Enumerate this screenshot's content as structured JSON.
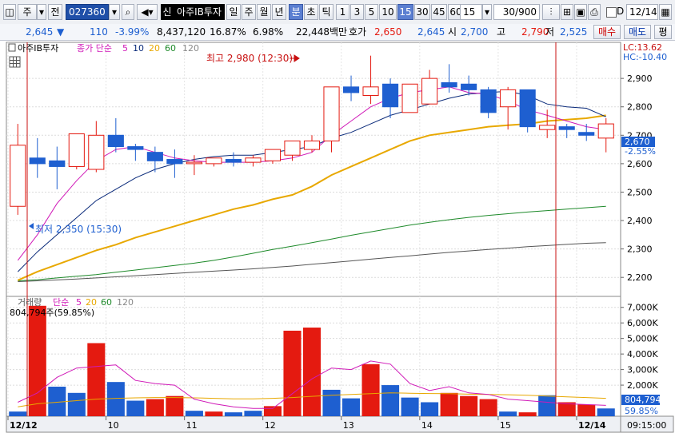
{
  "toolbar": {
    "market": "주",
    "board": "전",
    "code": "027360",
    "company_badge": "신",
    "company": "아주IB투자",
    "periods": [
      "일",
      "주",
      "월",
      "년",
      "분",
      "초",
      "틱"
    ],
    "active_period": "분",
    "intervals": [
      "1",
      "3",
      "5",
      "10",
      "15",
      "30",
      "45",
      "60"
    ],
    "active_interval": "15",
    "interval_value": "15",
    "count": "30/900",
    "d_label": "D",
    "date": "12/14"
  },
  "quote": {
    "price": "2,645",
    "direction": "▼",
    "change": "110",
    "change_pct": "-3.99%",
    "volume": "8,437,120",
    "turnover": "16.87%",
    "ratio": "6.98%",
    "amount": "22,448백만",
    "ask_label": "호가",
    "ask": "2,650",
    "bid": "2,645",
    "open_label": "시",
    "open": "2,700",
    "high_label": "고",
    "high": "2,790",
    "low_label": "저",
    "low": "2,525",
    "buy_label": "매수",
    "sell_label": "매도",
    "eval_label": "평"
  },
  "price_panel": {
    "name": "아주IB투자",
    "ma_label": "종가 단순",
    "ma_periods": [
      "5",
      "10",
      "20",
      "60",
      "120"
    ],
    "lc": "LC:13.62",
    "hc": "HC:-10.40",
    "high_note": "최고 2,980 (12:30)",
    "low_note": "최저 2,350 (15:30)",
    "current_price": "2,670",
    "current_pct": "-2.55%",
    "y_ticks": [
      "2,900",
      "2,800",
      "2,700",
      "2,600",
      "2,500",
      "2,400",
      "2,300",
      "2,200"
    ]
  },
  "volume_panel": {
    "label": "거래량",
    "ma_label": "단순",
    "ma_periods": [
      "5",
      "20",
      "60",
      "120"
    ],
    "summary": "804,794주(59.85%)",
    "current_volume": "804,794",
    "current_pct": "59.85%",
    "y_ticks": [
      "7,000K",
      "6,000K",
      "5,000K",
      "4,000K",
      "3,000K",
      "2,000K"
    ]
  },
  "x_axis": {
    "labels": [
      "12/12",
      "10",
      "11",
      "12",
      "13",
      "14",
      "15",
      "12/14"
    ],
    "time": "09:15:00"
  },
  "colors": {
    "up": "#e41a10",
    "down": "#1e5fd0",
    "ma5": "#d01ab8",
    "ma10": "#0a2a7a",
    "ma20": "#e8a800",
    "ma60": "#1e8a2a",
    "ma120": "#555555",
    "cursor": "#c81010"
  },
  "chart_data": [
    {
      "type": "candlestick",
      "title": "아주IB투자",
      "unit": "KRW",
      "ylim": [
        2150,
        3010
      ],
      "x": [
        "12/12 14:00",
        "12/12 14:15",
        "12/12 14:30",
        "12/12 14:45",
        "12/12 15:00",
        "12/12 15:15",
        "12/13 09:00",
        "12/13 09:15",
        "12/13 09:30",
        "12/13 09:45",
        "12/13 10:00",
        "12/13 10:15",
        "12/13 10:30",
        "12/13 10:45",
        "12/13 11:00",
        "12/13 11:15",
        "12/13 11:30",
        "12/13 11:45",
        "12/13 12:00",
        "12/13 12:15",
        "12/13 12:30",
        "12/13 12:45",
        "12/13 13:00",
        "12/13 13:15",
        "12/13 13:30",
        "12/13 13:45",
        "12/13 14:00",
        "12/13 14:15",
        "12/13 14:30",
        "12/13 14:45",
        "12/14 09:00"
      ],
      "open": [
        2450,
        2620,
        2610,
        2590,
        2580,
        2700,
        2660,
        2640,
        2615,
        2600,
        2600,
        2615,
        2605,
        2610,
        2630,
        2650,
        2680,
        2870,
        2840,
        2880,
        2780,
        2810,
        2885,
        2880,
        2860,
        2800,
        2860,
        2720,
        2730,
        2710,
        2690
      ],
      "high": [
        2740,
        2690,
        2660,
        2600,
        2750,
        2760,
        2670,
        2660,
        2650,
        2630,
        2620,
        2640,
        2630,
        2640,
        2680,
        2700,
        2860,
        2910,
        2980,
        2900,
        2880,
        2930,
        2950,
        2910,
        2870,
        2870,
        2850,
        2790,
        2740,
        2740,
        2760
      ],
      "close": [
        2665,
        2600,
        2590,
        2705,
        2700,
        2660,
        2650,
        2610,
        2600,
        2605,
        2620,
        2605,
        2620,
        2650,
        2680,
        2680,
        2870,
        2850,
        2870,
        2800,
        2880,
        2900,
        2870,
        2860,
        2780,
        2860,
        2730,
        2735,
        2720,
        2700,
        2740
      ],
      "low": [
        2420,
        2550,
        2510,
        2580,
        2570,
        2640,
        2610,
        2570,
        2550,
        2560,
        2590,
        2590,
        2590,
        2600,
        2610,
        2640,
        2640,
        2820,
        2810,
        2760,
        2780,
        2860,
        2850,
        2840,
        2760,
        2720,
        2710,
        2690,
        2690,
        2680,
        2640
      ],
      "ma5": [
        2260,
        2350,
        2460,
        2540,
        2610,
        2650,
        2660,
        2640,
        2620,
        2610,
        2605,
        2605,
        2605,
        2610,
        2620,
        2640,
        2700,
        2750,
        2800,
        2830,
        2850,
        2860,
        2870,
        2850,
        2845,
        2820,
        2790,
        2770,
        2750,
        2730,
        2720
      ],
      "ma10": [
        2220,
        2290,
        2350,
        2410,
        2470,
        2510,
        2550,
        2580,
        2600,
        2615,
        2625,
        2630,
        2630,
        2640,
        2650,
        2660,
        2690,
        2710,
        2740,
        2770,
        2790,
        2810,
        2830,
        2845,
        2850,
        2855,
        2840,
        2810,
        2800,
        2795,
        2765
      ],
      "ma20": [
        2190,
        2220,
        2245,
        2270,
        2295,
        2315,
        2340,
        2360,
        2380,
        2400,
        2420,
        2440,
        2455,
        2475,
        2490,
        2520,
        2560,
        2590,
        2620,
        2650,
        2680,
        2700,
        2710,
        2720,
        2730,
        2735,
        2740,
        2750,
        2755,
        2760,
        2770
      ],
      "ma60": [
        2188,
        2192,
        2198,
        2204,
        2210,
        2218,
        2226,
        2234,
        2242,
        2250,
        2260,
        2272,
        2285,
        2298,
        2310,
        2322,
        2335,
        2348,
        2360,
        2372,
        2384,
        2394,
        2403,
        2411,
        2418,
        2424,
        2430,
        2435,
        2440,
        2445,
        2450
      ],
      "ma120": [
        2185,
        2188,
        2191,
        2194,
        2198,
        2202,
        2206,
        2210,
        2214,
        2218,
        2222,
        2226,
        2230,
        2235,
        2240,
        2246,
        2252,
        2258,
        2264,
        2270,
        2276,
        2282,
        2288,
        2293,
        2298,
        2303,
        2308,
        2312,
        2316,
        2320,
        2322
      ],
      "annotations": [
        "최고 2,980 (12:30)",
        "최저 2,350 (15:30)"
      ]
    },
    {
      "type": "bar",
      "title": "거래량",
      "unit": "K shares",
      "ylim": [
        0,
        7500
      ],
      "x": [
        "12/12 14:00",
        "12/12 14:15",
        "12/12 14:30",
        "12/12 14:45",
        "12/12 15:00",
        "12/12 15:15",
        "12/13 09:00",
        "12/13 09:15",
        "12/13 09:30",
        "12/13 09:45",
        "12/13 10:00",
        "12/13 10:15",
        "12/13 10:30",
        "12/13 10:45",
        "12/13 11:00",
        "12/13 11:15",
        "12/13 11:30",
        "12/13 11:45",
        "12/13 12:00",
        "12/13 12:15",
        "12/13 12:30",
        "12/13 12:45",
        "12/13 13:00",
        "12/13 13:15",
        "12/13 13:30",
        "12/13 13:45",
        "12/13 14:00",
        "12/13 14:15",
        "12/13 14:30",
        "12/13 14:45",
        "12/14 09:00"
      ],
      "values": [
        300,
        7100,
        1900,
        1500,
        4700,
        2200,
        1000,
        1100,
        1300,
        350,
        300,
        250,
        350,
        650,
        5500,
        5700,
        1700,
        1150,
        3350,
        2000,
        1200,
        900,
        1500,
        1300,
        1100,
        300,
        250,
        1350,
        900,
        750,
        500
      ],
      "up": [
        false,
        true,
        false,
        false,
        true,
        false,
        false,
        true,
        true,
        false,
        true,
        false,
        false,
        true,
        true,
        true,
        false,
        false,
        true,
        false,
        false,
        false,
        true,
        true,
        true,
        false,
        true,
        false,
        true,
        true,
        false
      ],
      "ma5": [
        900,
        1500,
        2500,
        3100,
        3200,
        3300,
        2300,
        2100,
        2000,
        1100,
        800,
        600,
        500,
        500,
        1450,
        2400,
        3100,
        3000,
        3550,
        3350,
        2100,
        1650,
        1900,
        1500,
        1400,
        1100,
        1000,
        900,
        800,
        750,
        700
      ],
      "ma20": [
        600,
        800,
        900,
        1000,
        1100,
        1150,
        1180,
        1200,
        1200,
        1180,
        1150,
        1120,
        1120,
        1150,
        1200,
        1280,
        1350,
        1400,
        1450,
        1500,
        1480,
        1460,
        1450,
        1420,
        1400,
        1380,
        1350,
        1300,
        1250,
        1200,
        1150
      ]
    }
  ]
}
